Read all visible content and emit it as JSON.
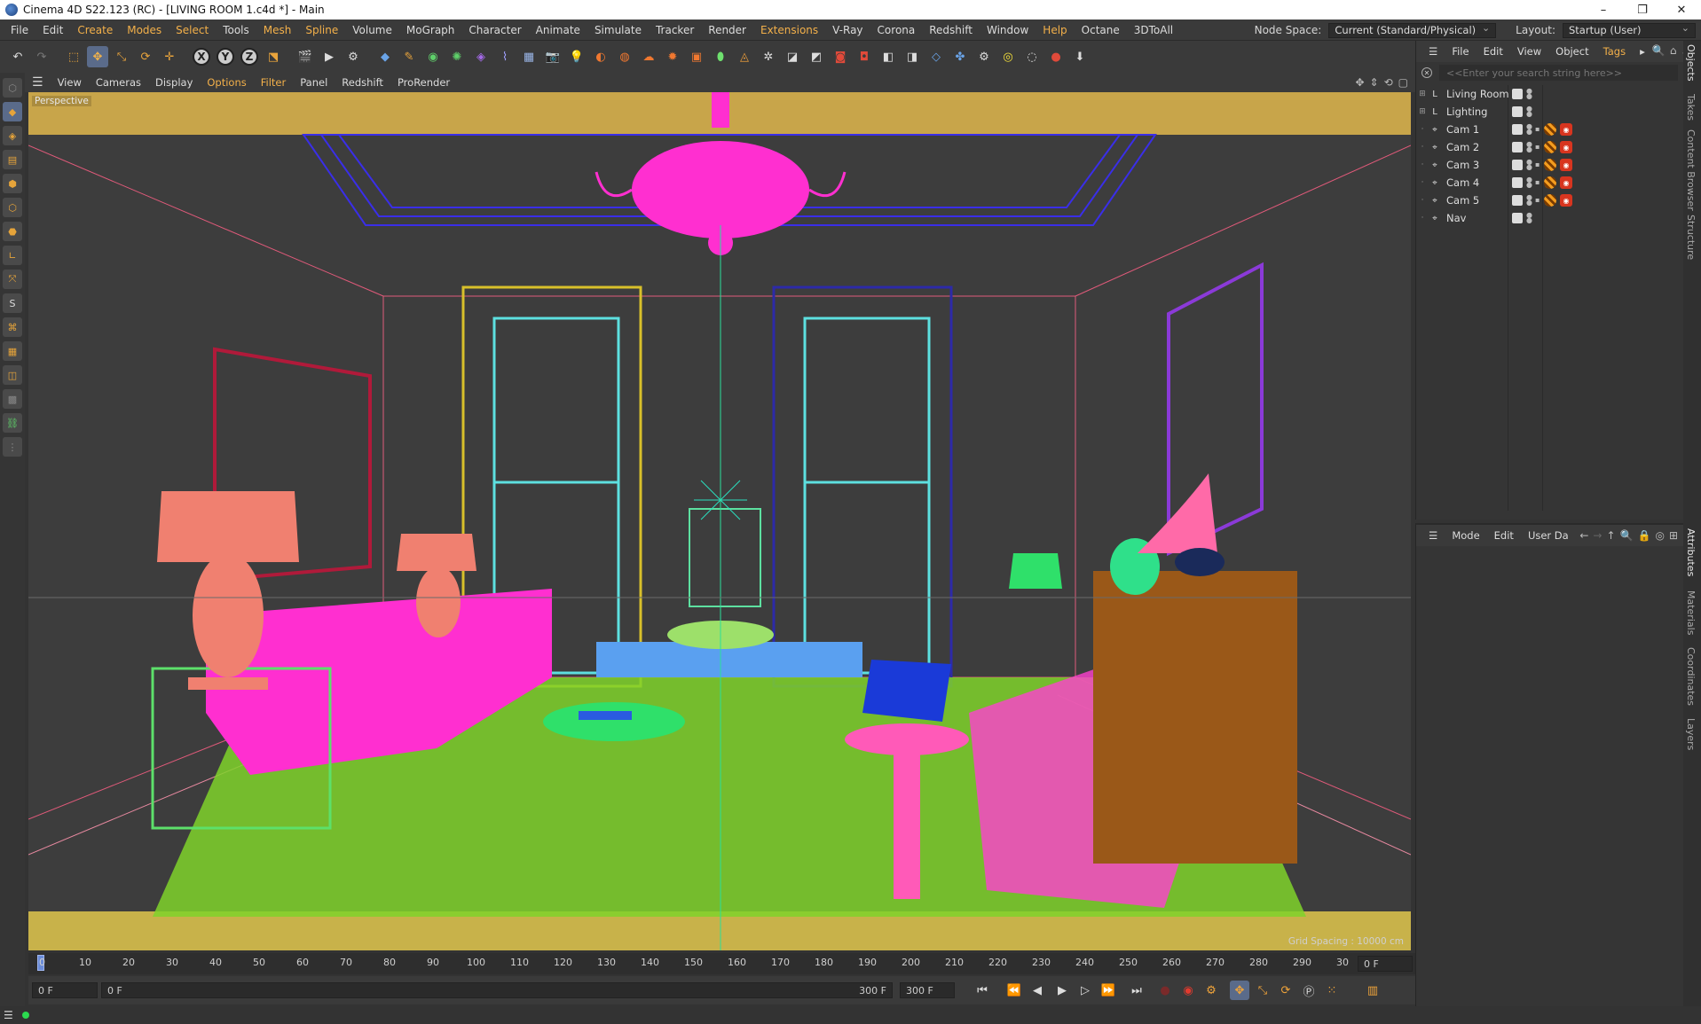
{
  "window": {
    "title": "Cinema 4D S22.123 (RC) - [LIVING ROOM 1.c4d *] - Main",
    "controls": [
      "–",
      "❐",
      "✕"
    ]
  },
  "menu": {
    "items": [
      "File",
      "Edit",
      "Create",
      "Modes",
      "Select",
      "Tools",
      "Mesh",
      "Spline",
      "Volume",
      "MoGraph",
      "Character",
      "Animate",
      "Simulate",
      "Tracker",
      "Render",
      "Extensions",
      "V-Ray",
      "Corona",
      "Redshift",
      "Window",
      "Help",
      "Octane",
      "3DToAll"
    ],
    "highlighted": [
      "Create",
      "Modes",
      "Select",
      "Mesh",
      "Spline",
      "Extensions",
      "Help"
    ],
    "node_space_label": "Node Space:",
    "node_space_value": "Current (Standard/Physical)",
    "layout_label": "Layout:",
    "layout_value": "Startup (User)"
  },
  "viewport_menu": {
    "items": [
      "View",
      "Cameras",
      "Display",
      "Options",
      "Filter",
      "Panel",
      "Redshift",
      "ProRender"
    ],
    "highlighted": [
      "Options",
      "Filter"
    ],
    "view_name": "Perspective",
    "grid_spacing": "Grid Spacing : 10000 cm"
  },
  "timeline": {
    "ticks": [
      "0",
      "10",
      "20",
      "30",
      "40",
      "50",
      "60",
      "70",
      "80",
      "90",
      "100",
      "110",
      "120",
      "130",
      "140",
      "150",
      "160",
      "170",
      "180",
      "190",
      "200",
      "210",
      "220",
      "230",
      "240",
      "250",
      "260",
      "270",
      "280",
      "290",
      "30"
    ],
    "current_frame": "0 F"
  },
  "transport": {
    "start_field": "0 F",
    "range_start": "0 F",
    "range_end": "300 F",
    "end_field": "300 F"
  },
  "object_manager": {
    "menu": [
      "File",
      "Edit",
      "View",
      "Object",
      "Tags"
    ],
    "highlighted": [
      "Tags"
    ],
    "search_placeholder": "<<Enter your search string here>>",
    "objects": [
      {
        "name": "Living Room",
        "type": "layer"
      },
      {
        "name": "Lighting",
        "type": "layer"
      },
      {
        "name": "Cam 1",
        "type": "camera"
      },
      {
        "name": "Cam 2",
        "type": "camera"
      },
      {
        "name": "Cam 3",
        "type": "camera"
      },
      {
        "name": "Cam 4",
        "type": "camera"
      },
      {
        "name": "Cam 5",
        "type": "camera"
      },
      {
        "name": "Nav",
        "type": "camera"
      }
    ]
  },
  "attribute_manager": {
    "menu": [
      "Mode",
      "Edit",
      "User Da"
    ]
  },
  "right_tabs": {
    "top": [
      "Objects",
      "Takes",
      "Content Browser",
      "Structure"
    ],
    "bottom": [
      "Attributes",
      "Materials",
      "Coordinates",
      "Layers"
    ]
  }
}
